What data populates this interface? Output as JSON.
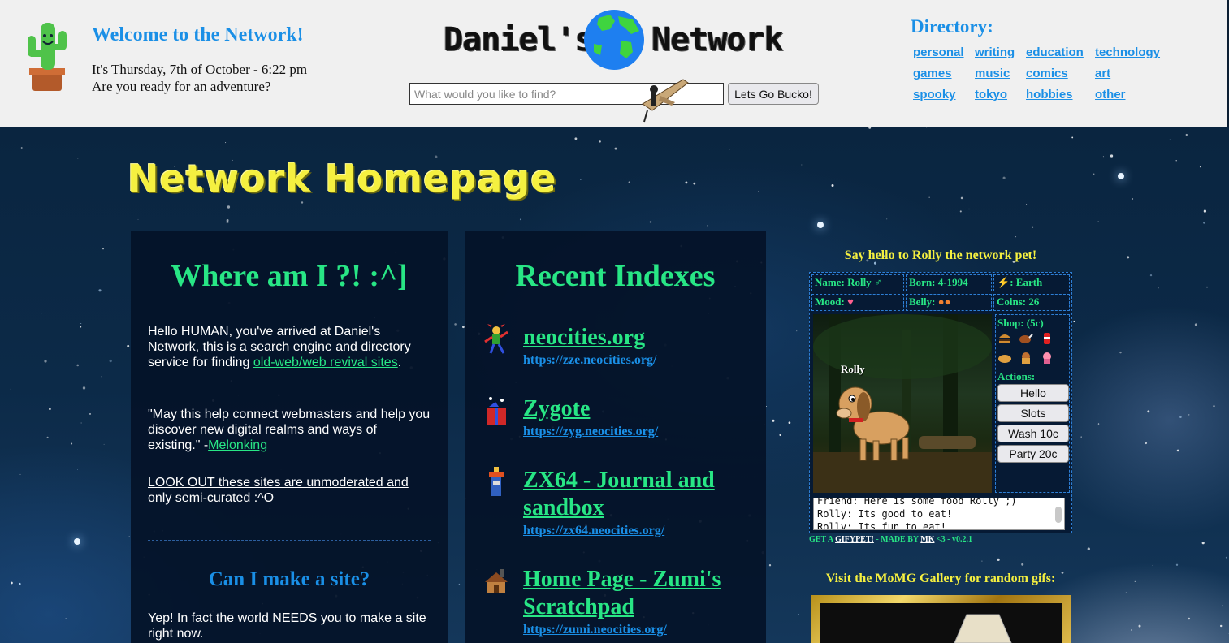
{
  "header": {
    "welcome_title": "Welcome to the Network!",
    "date_line": "It's Thursday, 7th of October - 6:22 pm",
    "adventure_line": "Are you ready for an adventure?",
    "logo_left": "Daniel's",
    "logo_right": "Network",
    "search": {
      "placeholder": "What would you like to find?",
      "value": "",
      "button_label": "Lets Go Bucko!"
    },
    "directory": {
      "title": "Directory:",
      "links": [
        "personal",
        "writing",
        "education",
        "technology",
        "games",
        "music",
        "comics",
        "art",
        "spooky",
        "tokyo",
        "hobbies",
        "other"
      ]
    }
  },
  "page_title": "Network Homepage",
  "where_panel": {
    "heading": "Where am I ?! :^]",
    "intro_text": "Hello HUMAN, you've arrived at Daniel's Network, this is a search engine and directory service for finding",
    "intro_link": "old-web/web revival sites",
    "intro_end": ".",
    "quote_text": "\"May this help connect webmasters and help you discover new digital realms and ways of existing.\" -",
    "quote_link": "Melonking",
    "lookout_link": "LOOK OUT these sites are unmoderated and only semi-curated",
    "lookout_end": " :^O",
    "make_site_heading": "Can I make a site?",
    "make_site_text": "Yep! In fact the world NEEDS you to make a site right now."
  },
  "recent_panel": {
    "heading": "Recent Indexes",
    "items": [
      {
        "title": "neocities.org",
        "url": "https://zze.neocities.org/"
      },
      {
        "title": "Zygote",
        "url": "https://zyg.neocities.org/"
      },
      {
        "title": "ZX64 - Journal and sandbox",
        "url": "https://zx64.neocities.org/"
      },
      {
        "title": "Home Page - Zumi's Scratchpad",
        "url": "https://zumi.neocities.org/"
      }
    ]
  },
  "pet": {
    "hello": "Say hello to Rolly the network pet!",
    "name": "Name: Rolly",
    "born": "Born: 4-1994",
    "planet": "Earth",
    "mood": "Mood:",
    "belly": "Belly:",
    "coins": "Coins: 26",
    "overlay_name": "Rolly",
    "shop_label": "Shop: (5c)",
    "actions_label": "Actions:",
    "buttons": [
      "Hello",
      "Slots",
      "Wash 10c",
      "Party 20c"
    ],
    "chat": [
      "Friend: Here is some food Rolly ;)",
      "Rolly: Its good to eat!",
      "Rolly: Its fun to eat!"
    ],
    "credit_get": "GET A ",
    "credit_link": "GIFYPET!",
    "credit_mid": " - MADE BY ",
    "credit_author": "MK",
    "credit_end": " <3 - v0.2.1"
  },
  "momg": {
    "title": "Visit the MoMG Gallery for random gifs:"
  },
  "colors": {
    "accent_blue": "#1a8fe6",
    "accent_green": "#28e685",
    "title_yellow": "#f5f040",
    "panel_bg": "#04122a"
  }
}
